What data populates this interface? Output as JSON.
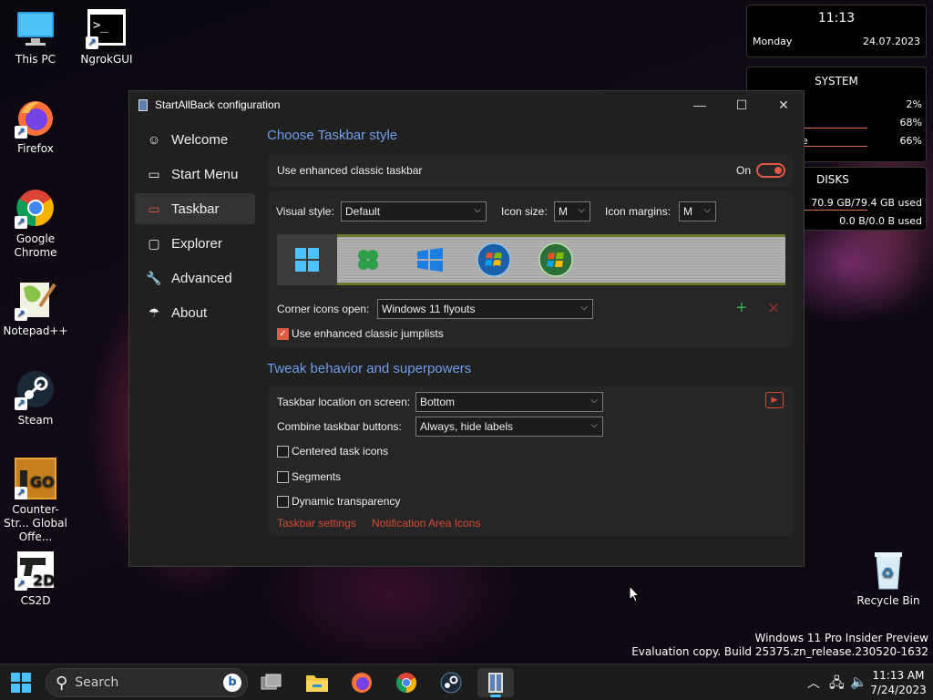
{
  "desktop_icons": [
    {
      "label": "This PC",
      "icon": "monitor-icon"
    },
    {
      "label": "NgrokGUI",
      "icon": "terminal-icon"
    },
    {
      "label": "Firefox",
      "icon": "firefox-icon"
    },
    {
      "label": "Google Chrome",
      "icon": "chrome-icon"
    },
    {
      "label": "Notepad++",
      "icon": "notepadpp-icon"
    },
    {
      "label": "Steam",
      "icon": "steam-icon"
    },
    {
      "label": "Counter-Str... Global Offe...",
      "icon": "csgo-icon"
    },
    {
      "label": "CS2D",
      "icon": "cs2d-icon"
    },
    {
      "label": "Recycle Bin",
      "icon": "recycle-bin-icon"
    }
  ],
  "widgets": {
    "clock": {
      "time": "11:13",
      "day": "Monday",
      "date": "24.07.2023"
    },
    "system": {
      "title": "SYSTEM",
      "rows": [
        {
          "label": "",
          "value": "2%"
        },
        {
          "label": "",
          "value": "68%"
        },
        {
          "label": "e",
          "value": "66%"
        }
      ]
    },
    "disks": {
      "title": "DISKS",
      "rows": [
        {
          "value": "70.9 GB/79.4 GB used"
        },
        {
          "value": "0.0 B/0.0 B used"
        }
      ]
    }
  },
  "window": {
    "title": "StartAllBack configuration",
    "controls": {
      "minimize": "—",
      "maximize": "☐",
      "close": "✕"
    },
    "nav": [
      {
        "label": "Welcome",
        "icon": "smile-icon",
        "glyph": "☺"
      },
      {
        "label": "Start Menu",
        "icon": "start-menu-icon",
        "glyph": "▭"
      },
      {
        "label": "Taskbar",
        "icon": "taskbar-icon",
        "glyph": "▭"
      },
      {
        "label": "Explorer",
        "icon": "explorer-icon",
        "glyph": "▢"
      },
      {
        "label": "Advanced",
        "icon": "wrench-icon",
        "glyph": "🔧"
      },
      {
        "label": "About",
        "icon": "about-icon",
        "glyph": "☂"
      }
    ],
    "selected_nav": "Taskbar",
    "section1": {
      "header": "Choose Taskbar style",
      "enhanced_label": "Use enhanced classic taskbar",
      "toggle_label": "On",
      "visual_style_label": "Visual style:",
      "visual_style_value": "Default",
      "icon_size_label": "Icon size:",
      "icon_size_value": "M",
      "icon_margins_label": "Icon margins:",
      "icon_margins_value": "M",
      "styles": [
        "windows-11-logo-icon",
        "clover-icon",
        "windows-10-logo-icon",
        "windows-7-orb-icon",
        "windows-vista-orb-icon"
      ],
      "corner_label": "Corner icons open:",
      "corner_value": "Windows 11 flyouts",
      "jumplists_label": "Use enhanced classic jumplists",
      "jumplists_checked": true
    },
    "section2": {
      "header": "Tweak behavior and superpowers",
      "location_label": "Taskbar location on screen:",
      "location_value": "Bottom",
      "combine_label": "Combine taskbar buttons:",
      "combine_value": "Always, hide labels",
      "centered_label": "Centered task icons",
      "segments_label": "Segments",
      "dynamic_label": "Dynamic transparency",
      "link1": "Taskbar settings",
      "link2": "Notification Area Icons"
    }
  },
  "watermark": {
    "line1": "Windows 11 Pro Insider Preview",
    "line2": "Evaluation copy. Build 25375.zn_release.230520-1632"
  },
  "taskbar": {
    "search_placeholder": "Search",
    "time": "11:13 AM",
    "date": "7/24/2023"
  },
  "colors": {
    "accent": "#e05a45",
    "header": "#6e9ee8",
    "window_bg": "#202020",
    "panel_bg": "#262626"
  }
}
